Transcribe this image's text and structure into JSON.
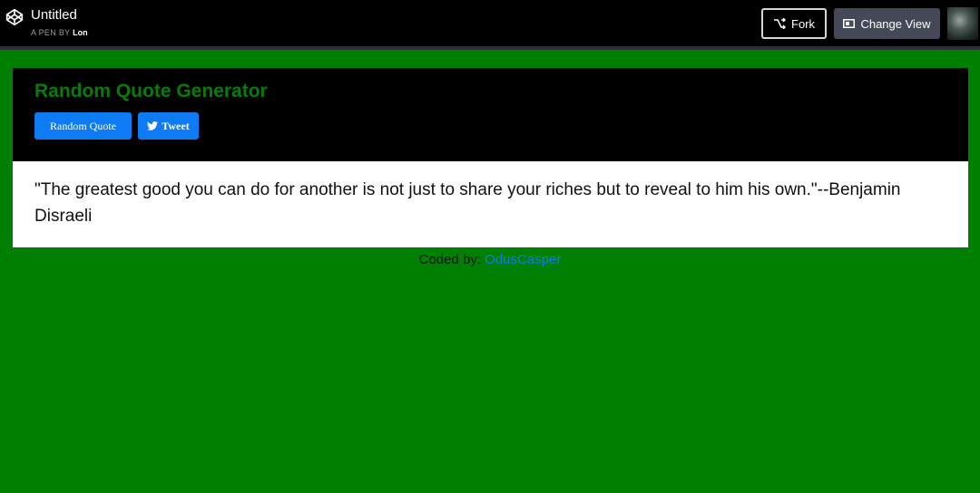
{
  "topbar": {
    "title": "Untitled",
    "pen_by_prefix": "A PEN BY",
    "author": "Lon",
    "fork_label": "Fork",
    "change_view_label": "Change View"
  },
  "app": {
    "title": "Random Quote Generator",
    "random_quote_label": "Random Quote",
    "tweet_label": "Tweet",
    "quote": "\"The greatest good you can do for another is not just to share your riches but to reveal to him his own.\"--Benjamin Disraeli"
  },
  "footer": {
    "coded_by_label": "Coded by:",
    "coder_link": "OdusCasper"
  },
  "colors": {
    "page_bg": "#008000",
    "title_green": "#0a7a0a",
    "button_blue": "#0d7bf3"
  },
  "icons": [
    "codepen-logo-icon",
    "fork-icon",
    "change-view-icon",
    "twitter-icon"
  ]
}
